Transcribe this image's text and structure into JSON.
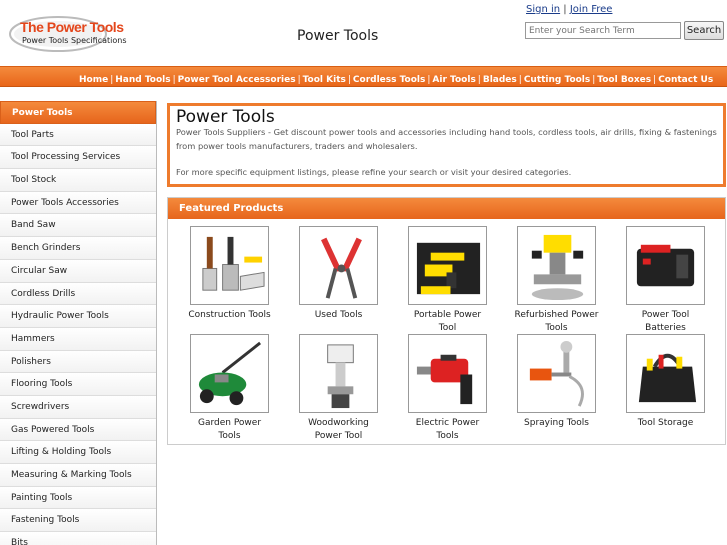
{
  "header": {
    "logo_title": "The Power Tools",
    "logo_sub": "Power Tools Specifications",
    "site_title": "Power Tools",
    "sign_in": "Sign in",
    "auth_sep": " | ",
    "join_free": "Join Free",
    "search_placeholder": "Enter your Search Term",
    "search_button": "Search"
  },
  "topnav": [
    "Home",
    "Hand Tools",
    "Power Tool Accessories",
    "Tool Kits",
    "Cordless Tools",
    "Air Tools",
    "Blades",
    "Cutting Tools",
    "Tool Boxes",
    "Contact Us"
  ],
  "sidebar": [
    "Power Tools",
    "Tool Parts",
    "Tool Processing Services",
    "Tool Stock",
    "Power Tools Accessories",
    "Band Saw",
    "Bench Grinders",
    "Circular Saw",
    "Cordless Drills",
    "Hydraulic Power Tools",
    "Hammers",
    "Polishers",
    "Flooring Tools",
    "Screwdrivers",
    "Gas Powered Tools",
    "Lifting & Holding Tools",
    "Measuring & Marking Tools",
    "Painting Tools",
    "Fastening Tools",
    "Bits"
  ],
  "intro": {
    "title": "Power Tools",
    "text": "Power Tools Suppliers - Get discount power tools and accessories including hand tools, cordless tools, air drills, fixing & fastenings from power tools manufacturers, traders and wholesalers.",
    "more": "For more specific equipment listings, please refine your search or visit your desired categories."
  },
  "featured": {
    "heading": "Featured Products",
    "products": [
      {
        "label": "Construction Tools",
        "icon": "putty-knives-icon"
      },
      {
        "label": "Used Tools",
        "icon": "pliers-icon"
      },
      {
        "label": "Portable Power Tool",
        "icon": "cordless-drill-kit-icon"
      },
      {
        "label": "Refurbished Power Tools",
        "icon": "router-icon"
      },
      {
        "label": "Power Tool Batteries",
        "icon": "battery-icon"
      },
      {
        "label": "Garden Power Tools",
        "icon": "lawn-mower-icon"
      },
      {
        "label": "Woodworking Power Tool",
        "icon": "band-saw-icon"
      },
      {
        "label": "Electric Power Tools",
        "icon": "rotary-hammer-icon"
      },
      {
        "label": "Spraying Tools",
        "icon": "spray-gun-icon"
      },
      {
        "label": "Tool Storage",
        "icon": "tool-bag-icon"
      }
    ]
  },
  "colors": {
    "accent": "#ee7b2d",
    "nav_text": "#ffffff",
    "link": "#1a3c8a"
  }
}
